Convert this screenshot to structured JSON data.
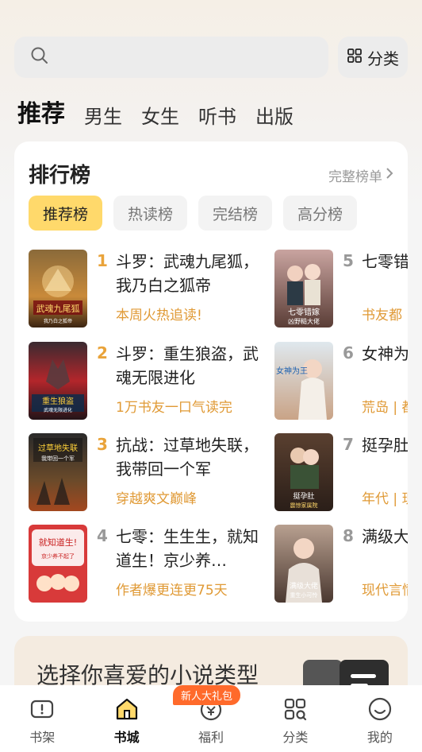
{
  "search": {
    "placeholder": "",
    "category_label": "分类"
  },
  "top_tabs": [
    "推荐",
    "男生",
    "女生",
    "听书",
    "出版"
  ],
  "rank": {
    "title": "排行榜",
    "more_label": "完整榜单",
    "tabs": [
      "推荐榜",
      "热读榜",
      "完结榜",
      "高分榜"
    ],
    "books": [
      {
        "rank": "1",
        "title": "斗罗：武魂九尾狐，我乃白之狐帝",
        "tag": "本周火热追读!"
      },
      {
        "rank": "2",
        "title": "斗罗：重生狼盗，武魂无限进化",
        "tag": "1万书友一口气读完"
      },
      {
        "rank": "3",
        "title": "抗战：过草地失联，我带回一个军",
        "tag": "穿越爽文巅峰"
      },
      {
        "rank": "4",
        "title": "七零：生生生，就知道生！京少养…",
        "tag": "作者爆更连更75天"
      },
      {
        "rank": "5",
        "title": "七零错嫁大佬，南",
        "tag": "书友都"
      },
      {
        "rank": "6",
        "title": "女神为王",
        "tag": "荒岛 | 都"
      },
      {
        "rank": "7",
        "title": "挺孕肚四宝震",
        "tag": "年代 | 现"
      },
      {
        "rank": "8",
        "title": "满级大佬怜，手",
        "tag": "现代言情"
      }
    ],
    "covers": [
      {
        "text": "武魂九尾狐",
        "sub": "我乃白之狐帝"
      },
      {
        "text": "重生狼盗",
        "sub": "武魂无限进化"
      },
      {
        "text": "过草地失联",
        "sub": "我带回一个军"
      },
      {
        "text": "就知道生!",
        "sub": "京少养不起了"
      },
      {
        "text": "七零错嫁",
        "sub": "凶野糙大佬"
      },
      {
        "text": "女神为王",
        "sub": ""
      },
      {
        "text": "挺孕肚",
        "sub": "震惊家属院"
      },
      {
        "text": "满级大佬",
        "sub": "重生小可怜"
      }
    ]
  },
  "genre": {
    "title": "选择你喜爱的小说类型"
  },
  "tabbar": {
    "items": [
      "书架",
      "书城",
      "福利",
      "分类",
      "我的"
    ],
    "gift_badge": "新人大礼包"
  },
  "colors": {
    "accent": "#ffd96b",
    "rank_top": "#e9a33a",
    "tag": "#e09a36",
    "badge": "#ff6a2b"
  }
}
